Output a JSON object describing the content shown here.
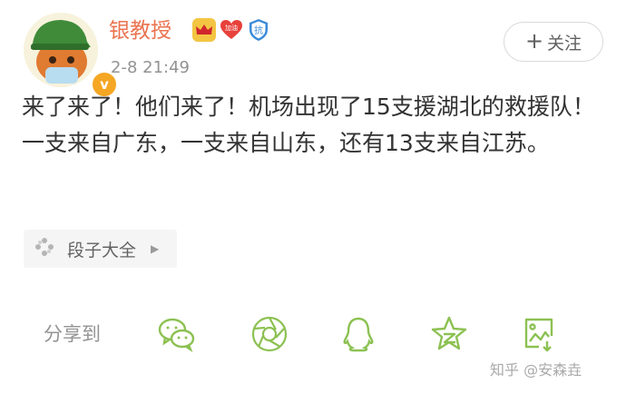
{
  "post": {
    "author_name": "银教授",
    "verified_mark": "v",
    "heart_badge_text": "加油",
    "shield_badge_text": "抗",
    "timestamp": "2-8 21:49",
    "follow_label": "关注",
    "follow_plus": "+",
    "text": "来了来了！他们来了！机场出现了15支援湖北的救援队！一支来自广东，一支来自山东，还有13支来自江苏。",
    "source_label": "段子大全"
  },
  "share": {
    "label": "分享到",
    "targets": [
      "wechat-icon",
      "moments-icon",
      "qq-icon",
      "qzone-icon",
      "save-image-icon"
    ]
  },
  "watermark": "知乎 @安森垚",
  "colors": {
    "author": "#eb7350",
    "share_icon": "#8cc152",
    "body_text": "#333333",
    "meta_gray": "#939393"
  }
}
